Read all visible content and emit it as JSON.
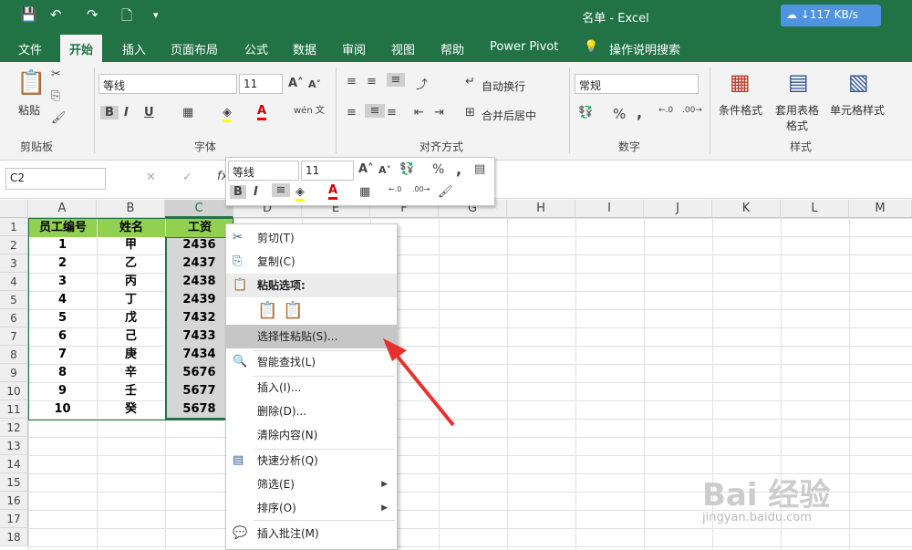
{
  "window": {
    "title": "名单 - Excel",
    "speed": "↓117 KB/s"
  },
  "quick_access": {
    "save": "💾",
    "undo": "↶",
    "redo": "↷",
    "preview": "🗋",
    "more": "▾"
  },
  "tabs": [
    "文件",
    "开始",
    "插入",
    "页面布局",
    "公式",
    "数据",
    "审阅",
    "视图",
    "帮助",
    "Power Pivot",
    "操作说明搜索"
  ],
  "ribbon": {
    "clipboard": {
      "paste": "粘贴",
      "group": "剪贴板"
    },
    "font": {
      "name": "等线",
      "size": "11",
      "group": "字体",
      "bold": "B",
      "italic": "I",
      "underline": "U",
      "wen": "wén 文"
    },
    "align": {
      "wrap": "自动换行",
      "merge": "合并后居中",
      "group": "对齐方式"
    },
    "number": {
      "format": "常规",
      "percent": "%",
      "comma": ",",
      "group": "数字"
    },
    "styles": {
      "cond": "条件格式",
      "table": "套用表格格式",
      "cell": "单元格样式",
      "group": "样式"
    }
  },
  "formula_bar": {
    "name_box": "C2",
    "fx": "fx"
  },
  "columns": [
    "A",
    "B",
    "C",
    "D",
    "E",
    "F",
    "G",
    "H",
    "I",
    "J",
    "K",
    "L",
    "M"
  ],
  "rows": [
    "1",
    "2",
    "3",
    "4",
    "5",
    "6",
    "7",
    "8",
    "9",
    "10",
    "11",
    "12",
    "13",
    "14",
    "15",
    "16",
    "17",
    "18"
  ],
  "table": {
    "headers": [
      "员工编号",
      "姓名",
      "工资"
    ],
    "rows": [
      [
        "1",
        "甲",
        "2436"
      ],
      [
        "2",
        "乙",
        "2437"
      ],
      [
        "3",
        "丙",
        "2438"
      ],
      [
        "4",
        "丁",
        "2439"
      ],
      [
        "5",
        "戊",
        "7432"
      ],
      [
        "6",
        "己",
        "7433"
      ],
      [
        "7",
        "庚",
        "7434"
      ],
      [
        "8",
        "辛",
        "5676"
      ],
      [
        "9",
        "壬",
        "5677"
      ],
      [
        "10",
        "癸",
        "5678"
      ]
    ]
  },
  "mini_toolbar": {
    "font": "等线",
    "size": "11",
    "bold": "B",
    "italic": "I",
    "percent": "%",
    "comma": ","
  },
  "context_menu": {
    "items": [
      {
        "label": "剪切(T)",
        "icon": "✂"
      },
      {
        "label": "复制(C)",
        "icon": "⎘"
      },
      {
        "label": "粘贴选项:",
        "icon": "📋"
      },
      {
        "label": "",
        "icon": ""
      },
      {
        "label": "选择性粘贴(S)...",
        "icon": ""
      },
      {
        "label": "智能查找(L)",
        "icon": "🔍"
      },
      {
        "label": "插入(I)...",
        "icon": ""
      },
      {
        "label": "删除(D)...",
        "icon": ""
      },
      {
        "label": "清除内容(N)",
        "icon": ""
      },
      {
        "label": "快速分析(Q)",
        "icon": "▤"
      },
      {
        "label": "筛选(E)",
        "icon": ""
      },
      {
        "label": "排序(O)",
        "icon": ""
      },
      {
        "label": "插入批注(M)",
        "icon": "💬"
      }
    ]
  },
  "watermark": {
    "brand": "Bai 经验",
    "url": "jingyan.baidu.com"
  },
  "colors": {
    "excel_green": "#217346",
    "header_fill": "#92d050",
    "selection": "#d6d6d6",
    "arrow": "#e8312e"
  }
}
